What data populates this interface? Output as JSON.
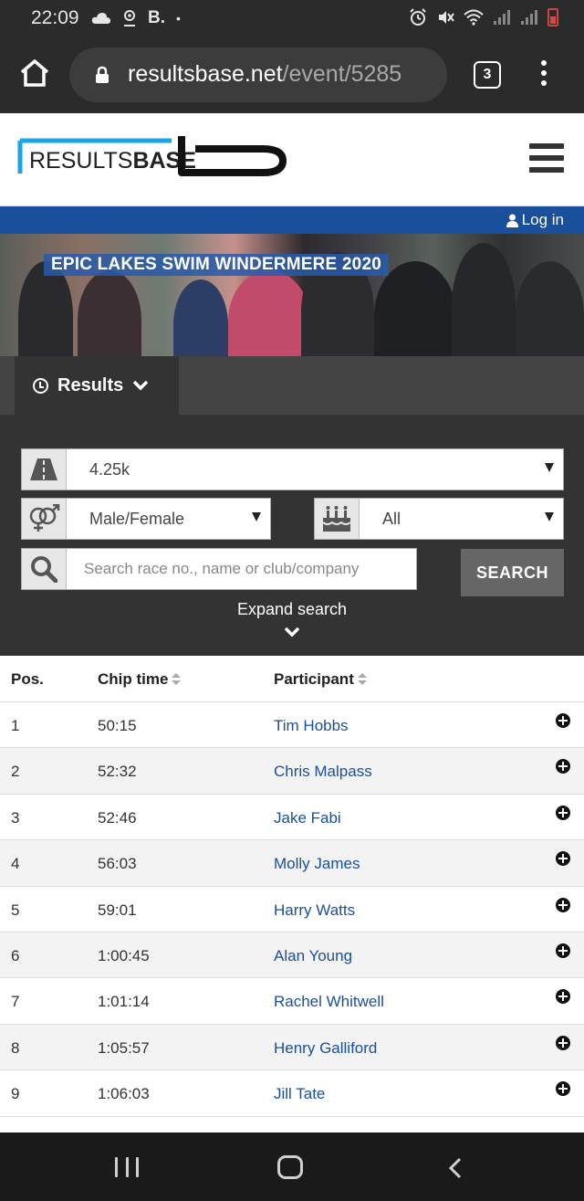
{
  "status_bar": {
    "time": "22:09",
    "left_glyphs": [
      "cloud-icon",
      "location-icon",
      "B.",
      "•"
    ],
    "battery_color": "#d24a4a"
  },
  "browser": {
    "url_domain": "resultsbase.net",
    "url_path": "/event/5285",
    "tab_count": "3"
  },
  "site": {
    "logo_text_left": "RESULTS",
    "logo_text_right": "BASE",
    "login_label": "Log in",
    "brand_blue": "#1a4f9c",
    "logo_accent": "#1aa3e8"
  },
  "banner": {
    "title": "EPIC LAKES SWIM WINDERMERE 2020"
  },
  "tabs": {
    "results_label": "Results"
  },
  "filters": {
    "distance": "4.25k",
    "gender": "Male/Female",
    "age_category": "All",
    "search_placeholder": "Search race no., name or club/company",
    "search_button": "SEARCH",
    "expand_label": "Expand search"
  },
  "table": {
    "headers": {
      "pos": "Pos.",
      "chip_time": "Chip time",
      "participant": "Participant"
    },
    "rows": [
      {
        "pos": "1",
        "time": "50:15",
        "name": "Tim Hobbs"
      },
      {
        "pos": "2",
        "time": "52:32",
        "name": "Chris Malpass"
      },
      {
        "pos": "3",
        "time": "52:46",
        "name": "Jake Fabi"
      },
      {
        "pos": "4",
        "time": "56:03",
        "name": "Molly James"
      },
      {
        "pos": "5",
        "time": "59:01",
        "name": "Harry Watts"
      },
      {
        "pos": "6",
        "time": "1:00:45",
        "name": "Alan Young"
      },
      {
        "pos": "7",
        "time": "1:01:14",
        "name": "Rachel Whitwell"
      },
      {
        "pos": "8",
        "time": "1:05:57",
        "name": "Henry Galliford"
      },
      {
        "pos": "9",
        "time": "1:06:03",
        "name": "Jill Tate"
      }
    ]
  }
}
